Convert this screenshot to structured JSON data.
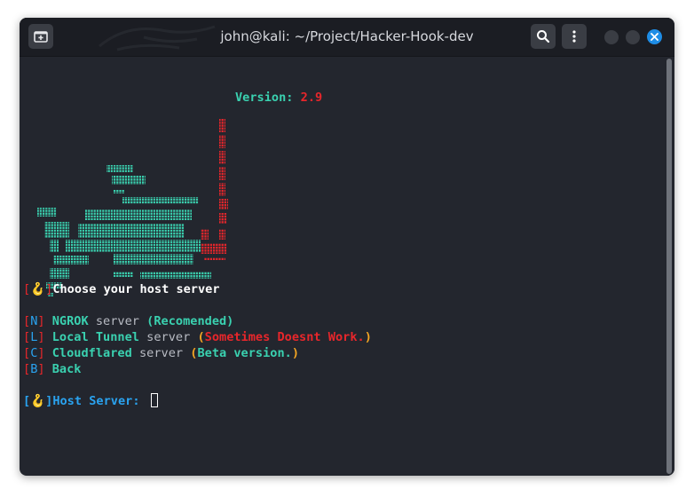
{
  "window": {
    "title": "john@kali: ~/Project/Hacker-Hook-dev"
  },
  "banner": {
    "version_label": "Version:",
    "version_value": "2.9"
  },
  "prompt": {
    "hook_glyph": "🪝",
    "question": "Choose your host server"
  },
  "options": [
    {
      "key": "N",
      "name": "NGROK",
      "suffix": "server",
      "note": "(Recomended)",
      "note_color": "green"
    },
    {
      "key": "L",
      "name": "Local Tunnel",
      "suffix": "server",
      "note": "(Sometimes Doesnt Work.)",
      "note_color": "red"
    },
    {
      "key": "C",
      "name": "Cloudflared",
      "suffix": "server",
      "note": "(Beta version.)",
      "note_color": "orange"
    },
    {
      "key": "B",
      "name": "Back",
      "suffix": "",
      "note": "",
      "note_color": ""
    }
  ],
  "input": {
    "label": "Host Server:",
    "value": ""
  },
  "colors": {
    "terminal_bg": "#23262e",
    "titlebar_bg": "#1b1d23",
    "green": "#3ad1b0",
    "red": "#e8262b",
    "orange": "#f5a623",
    "blue": "#2aa3f0",
    "close_button": "#1e8de6"
  },
  "icons": {
    "new_tab": "new-tab-icon",
    "search": "search-icon",
    "menu": "kebab-menu-icon",
    "close": "close-icon"
  }
}
